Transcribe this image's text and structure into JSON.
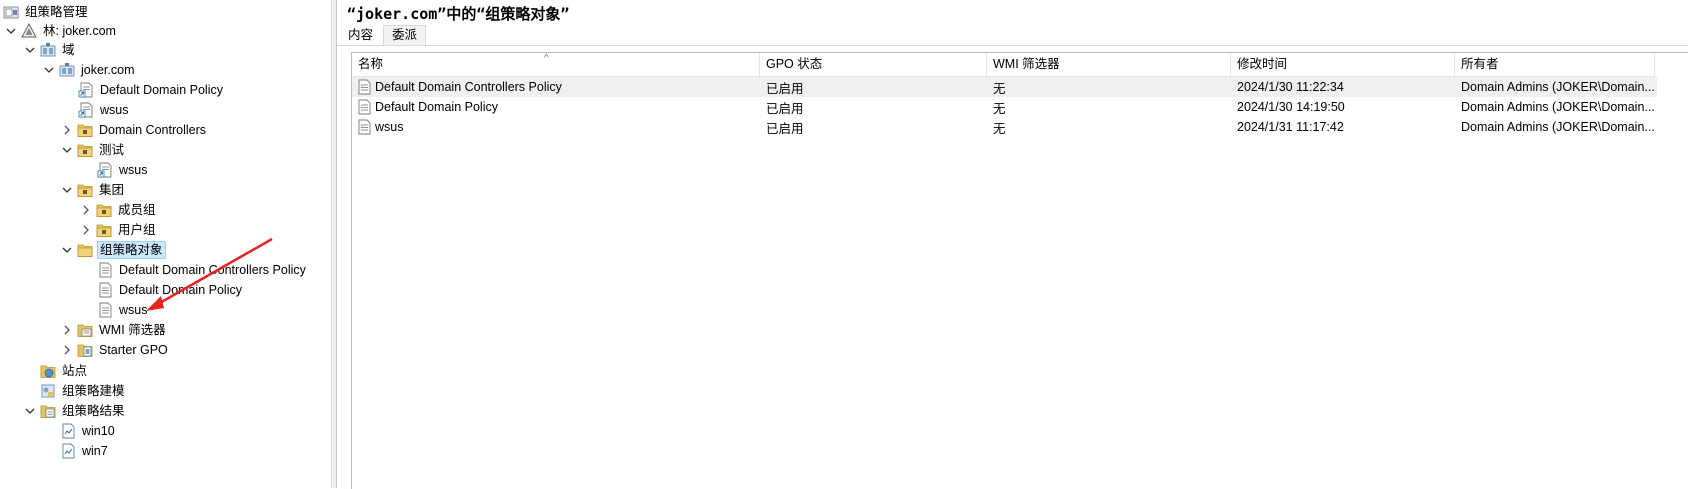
{
  "app": {
    "title": "组策略管理"
  },
  "tree": {
    "root_label": "组策略管理",
    "forest_label": "林: joker.com",
    "domains_label": "域",
    "domain_label": "joker.com",
    "items": {
      "ddp": "Default Domain Policy",
      "wsus1": "wsus",
      "dc": "Domain Controllers",
      "test": "测试",
      "test_wsus": "wsus",
      "group": "集团",
      "members": "成员组",
      "users": "用户组",
      "gpo": "组策略对象",
      "gpo_ddcp": "Default Domain Controllers Policy",
      "gpo_ddp": "Default Domain Policy",
      "gpo_wsus": "wsus",
      "wmi": "WMI 筛选器",
      "starter": "Starter GPO",
      "sites": "站点",
      "modeling": "组策略建模",
      "results": "组策略结果",
      "win10": "win10",
      "win7": "win7"
    }
  },
  "main": {
    "title": "“joker.com”中的“组策略对象”",
    "tabs": [
      "内容",
      "委派"
    ],
    "columns": [
      "名称",
      "GPO 状态",
      "WMI 筛选器",
      "修改时间",
      "所有者"
    ],
    "rows": [
      {
        "name": "Default Domain Controllers Policy",
        "status": "已启用",
        "wmi": "无",
        "modified": "2024/1/30 11:22:34",
        "owner": "Domain Admins (JOKER\\Domain..."
      },
      {
        "name": "Default Domain Policy",
        "status": "已启用",
        "wmi": "无",
        "modified": "2024/1/30 14:19:50",
        "owner": "Domain Admins (JOKER\\Domain..."
      },
      {
        "name": "wsus",
        "status": "已启用",
        "wmi": "无",
        "modified": "2024/1/31 11:17:42",
        "owner": "Domain Admins (JOKER\\Domain..."
      }
    ]
  },
  "colors": {
    "selection": "#cce8ff",
    "annotation_arrow": "#e8231f",
    "folder": "#e8c25a"
  }
}
